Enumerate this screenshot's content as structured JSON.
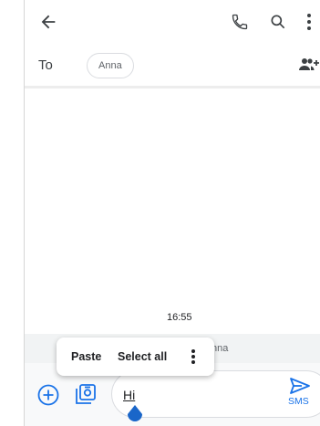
{
  "app_bar": {
    "back_icon": "arrow-back-icon",
    "actions": [
      "phone-icon",
      "search-icon",
      "more-vert-icon"
    ]
  },
  "recipient": {
    "to_label": "To",
    "chip_name": "Anna",
    "add_icon": "add-person-icon"
  },
  "conversation": {
    "timestamp": "16:55",
    "status_text": "nna"
  },
  "context_menu": {
    "paste_label": "Paste",
    "select_all_label": "Select all",
    "more_icon": "more-vert-icon"
  },
  "compose": {
    "attach_icon": "plus-circle-icon",
    "gallery_icon": "gallery-icon",
    "message_value": "Hi",
    "send_icon": "send-icon",
    "send_label": "SMS"
  },
  "colors": {
    "accent": "#1a73e8",
    "icon": "#5f6368",
    "text": "#202124"
  }
}
